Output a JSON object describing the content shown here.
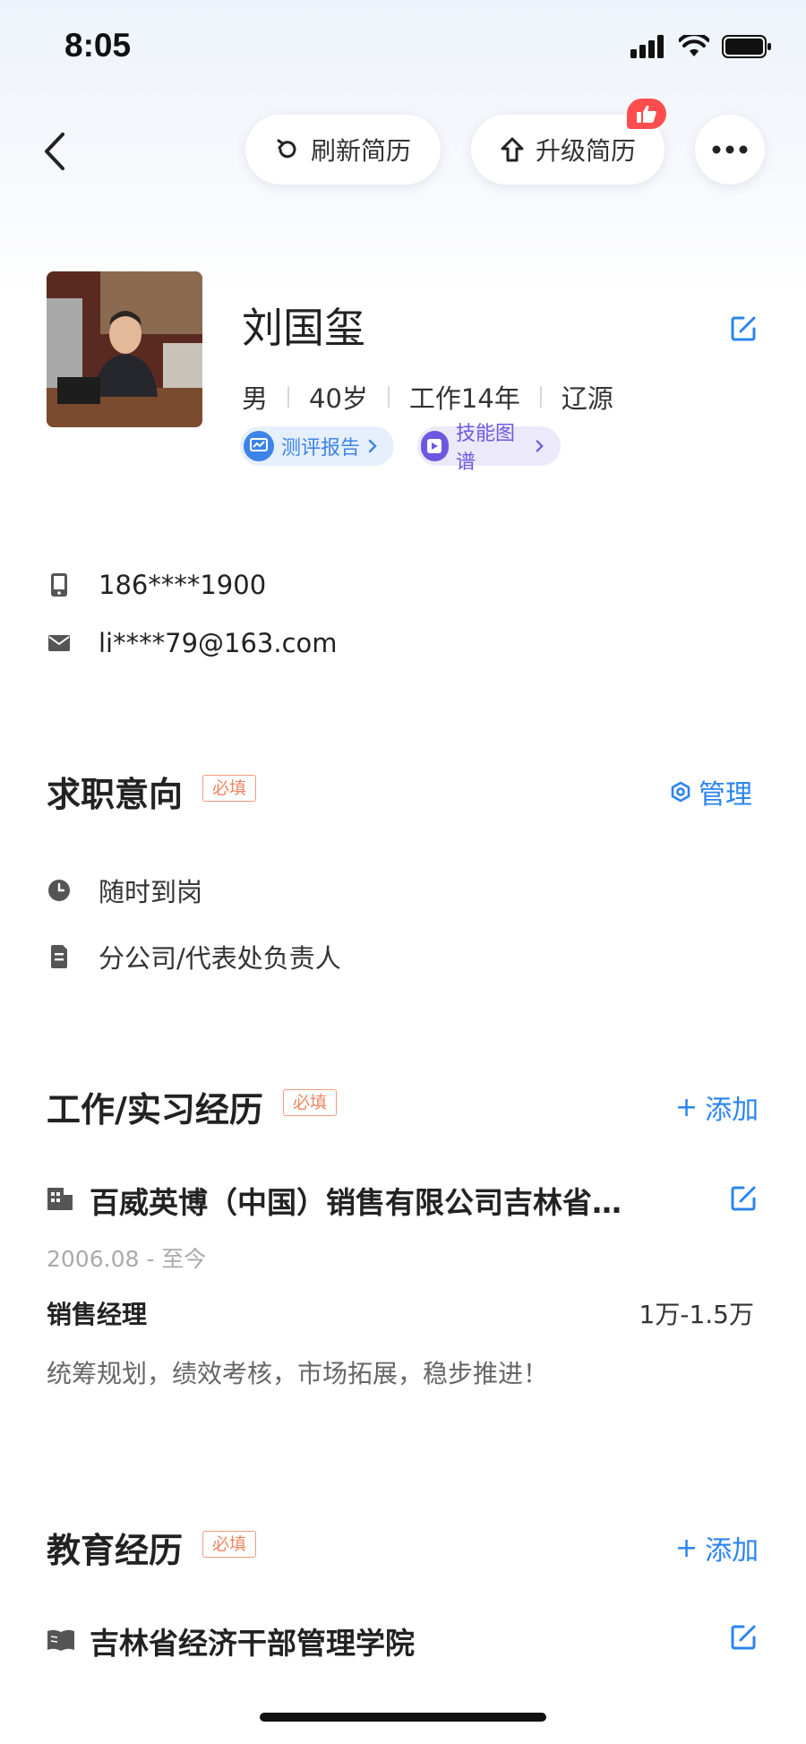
{
  "status_bar": {
    "time": "8:05"
  },
  "nav": {
    "refresh_label": "刷新简历",
    "upgrade_label": "升级简历"
  },
  "profile": {
    "name": "刘国玺",
    "gender": "男",
    "age": "40岁",
    "experience": "工作14年",
    "city": "辽源",
    "chips": {
      "report": "测评报告",
      "skill_map": "技能图谱"
    }
  },
  "contact": {
    "phone": "186****1900",
    "email": "li****79@163.com"
  },
  "job_intent": {
    "title": "求职意向",
    "required_tag": "必填",
    "manage_label": "管理",
    "availability": "随时到岗",
    "position": "分公司/代表处负责人"
  },
  "work_experience": {
    "title": "工作/实习经历",
    "required_tag": "必填",
    "add_label": "添加",
    "add_prefix": "+",
    "company": "百威英博（中国）销售有限公司吉林省…",
    "dates": "2006.08 - 至今",
    "job_title": "销售经理",
    "salary": "1万-1.5万",
    "description": "统筹规划，绩效考核，市场拓展，稳步推进！"
  },
  "education": {
    "title": "教育经历",
    "required_tag": "必填",
    "add_label": "添加",
    "add_prefix": "+",
    "school": "吉林省经济干部管理学院"
  },
  "colors": {
    "accent_blue": "#2a84f0",
    "required_orange": "#f08560",
    "badge_red": "#ff4d4f",
    "skill_purple": "#6f58e0"
  }
}
